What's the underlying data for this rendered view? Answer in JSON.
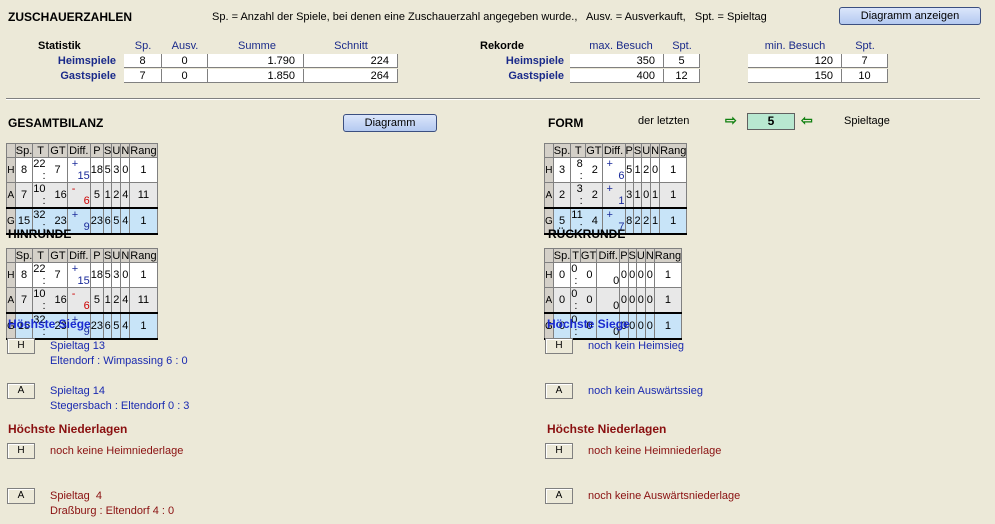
{
  "header": {
    "title": "ZUSCHAUERZAHLEN",
    "legend": "Sp. = Anzahl der Spiele, bei denen eine Zuschauerzahl angegeben wurde.,   Ausv. = Ausverkauft,   Spt. = Spieltag",
    "button": "Diagramm anzeigen"
  },
  "statistik": {
    "label": "Statistik",
    "cols": [
      "Sp.",
      "Ausv.",
      "Summe",
      "Schnitt"
    ],
    "rows": [
      {
        "label": "Heimspiele",
        "sp": "8",
        "ausv": "0",
        "summe": "1.790",
        "schnitt": "224"
      },
      {
        "label": "Gastspiele",
        "sp": "7",
        "ausv": "0",
        "summe": "1.850",
        "schnitt": "264"
      }
    ]
  },
  "rekorde": {
    "label": "Rekorde",
    "max_cols": [
      "max. Besuch",
      "Spt."
    ],
    "min_cols": [
      "min. Besuch",
      "Spt."
    ],
    "rows": [
      {
        "label": "Heimspiele",
        "max": "350",
        "max_spt": "5",
        "min": "120",
        "min_spt": "7"
      },
      {
        "label": "Gastspiele",
        "max": "400",
        "max_spt": "12",
        "min": "150",
        "min_spt": "10"
      }
    ]
  },
  "gesamt": {
    "title": "GESAMTBILANZ",
    "button": "Diagramm",
    "cols": [
      "Sp.",
      "T",
      "GT",
      "Diff.",
      "P",
      "S",
      "U",
      "N",
      "Rang"
    ],
    "rows": [
      {
        "k": "H",
        "sp": "8",
        "t": "22 :",
        "gt": "7",
        "sign": "+",
        "d": "15",
        "p": "18",
        "s": "5",
        "u": "3",
        "n": "0",
        "r": "1"
      },
      {
        "k": "A",
        "sp": "7",
        "t": "10 :",
        "gt": "16",
        "sign": "-",
        "d": "6",
        "p": "5",
        "s": "1",
        "u": "2",
        "n": "4",
        "r": "11"
      },
      {
        "k": "G",
        "sp": "15",
        "t": "32 :",
        "gt": "23",
        "sign": "+",
        "d": "9",
        "p": "23",
        "s": "6",
        "u": "5",
        "n": "4",
        "r": "1"
      }
    ]
  },
  "form": {
    "title": "FORM",
    "pre": "der letzten",
    "value": "5",
    "post": "Spieltage",
    "arrow_right": "⇨",
    "arrow_left": "⇦",
    "rows": [
      {
        "k": "H",
        "sp": "3",
        "t": "8 :",
        "gt": "2",
        "sign": "+",
        "d": "6",
        "p": "5",
        "s": "1",
        "u": "2",
        "n": "0",
        "r": "1"
      },
      {
        "k": "A",
        "sp": "2",
        "t": "3 :",
        "gt": "2",
        "sign": "+",
        "d": "1",
        "p": "3",
        "s": "1",
        "u": "0",
        "n": "1",
        "r": "1"
      },
      {
        "k": "G",
        "sp": "5",
        "t": "11 :",
        "gt": "4",
        "sign": "+",
        "d": "7",
        "p": "8",
        "s": "2",
        "u": "2",
        "n": "1",
        "r": "1"
      }
    ]
  },
  "hinrunde": {
    "title": "HINRUNDE",
    "rows": [
      {
        "k": "H",
        "sp": "8",
        "t": "22 :",
        "gt": "7",
        "sign": "+",
        "d": "15",
        "p": "18",
        "s": "5",
        "u": "3",
        "n": "0",
        "r": "1"
      },
      {
        "k": "A",
        "sp": "7",
        "t": "10 :",
        "gt": "16",
        "sign": "-",
        "d": "6",
        "p": "5",
        "s": "1",
        "u": "2",
        "n": "4",
        "r": "11"
      },
      {
        "k": "G",
        "sp": "15",
        "t": "32 :",
        "gt": "23",
        "sign": "+",
        "d": "9",
        "p": "23",
        "s": "6",
        "u": "5",
        "n": "4",
        "r": "1"
      }
    ]
  },
  "rueckrunde": {
    "title": "RÜCKRUNDE",
    "rows": [
      {
        "k": "H",
        "sp": "0",
        "t": "0 :",
        "gt": "0",
        "sign": "",
        "d": "0",
        "p": "0",
        "s": "0",
        "u": "0",
        "n": "0",
        "r": "1"
      },
      {
        "k": "A",
        "sp": "0",
        "t": "0 :",
        "gt": "0",
        "sign": "",
        "d": "0",
        "p": "0",
        "s": "0",
        "u": "0",
        "n": "0",
        "r": "1"
      },
      {
        "k": "G",
        "sp": "0",
        "t": "0 :",
        "gt": "0",
        "sign": "",
        "d": "0",
        "p": "0",
        "s": "0",
        "u": "0",
        "n": "0",
        "r": "1"
      }
    ]
  },
  "left_lists": {
    "siege_title": "Höchste Siege",
    "siege": [
      {
        "k": "H",
        "line1": "Spieltag 13",
        "line2": "Eltendorf : Wimpassing 6 : 0"
      },
      {
        "k": "A",
        "line1": "Spieltag 14",
        "line2": "Stegersbach : Eltendorf 0 : 3"
      }
    ],
    "nieder_title": "Höchste Niederlagen",
    "nieder": [
      {
        "k": "H",
        "line1": "noch keine Heimniederlage",
        "line2": ""
      },
      {
        "k": "A",
        "line1": "Spieltag  4",
        "line2": "Draßburg : Eltendorf 4 : 0"
      }
    ]
  },
  "right_lists": {
    "siege_title": "Höchste Siege",
    "siege": [
      {
        "k": "H",
        "line1": "noch kein Heimsieg"
      },
      {
        "k": "A",
        "line1": "noch kein Auswärtssieg"
      }
    ],
    "nieder_title": "Höchste Niederlagen",
    "nieder": [
      {
        "k": "H",
        "line1": "noch keine Heimniederlage"
      },
      {
        "k": "A",
        "line1": "noch keine Auswärtsniederlage"
      }
    ]
  }
}
